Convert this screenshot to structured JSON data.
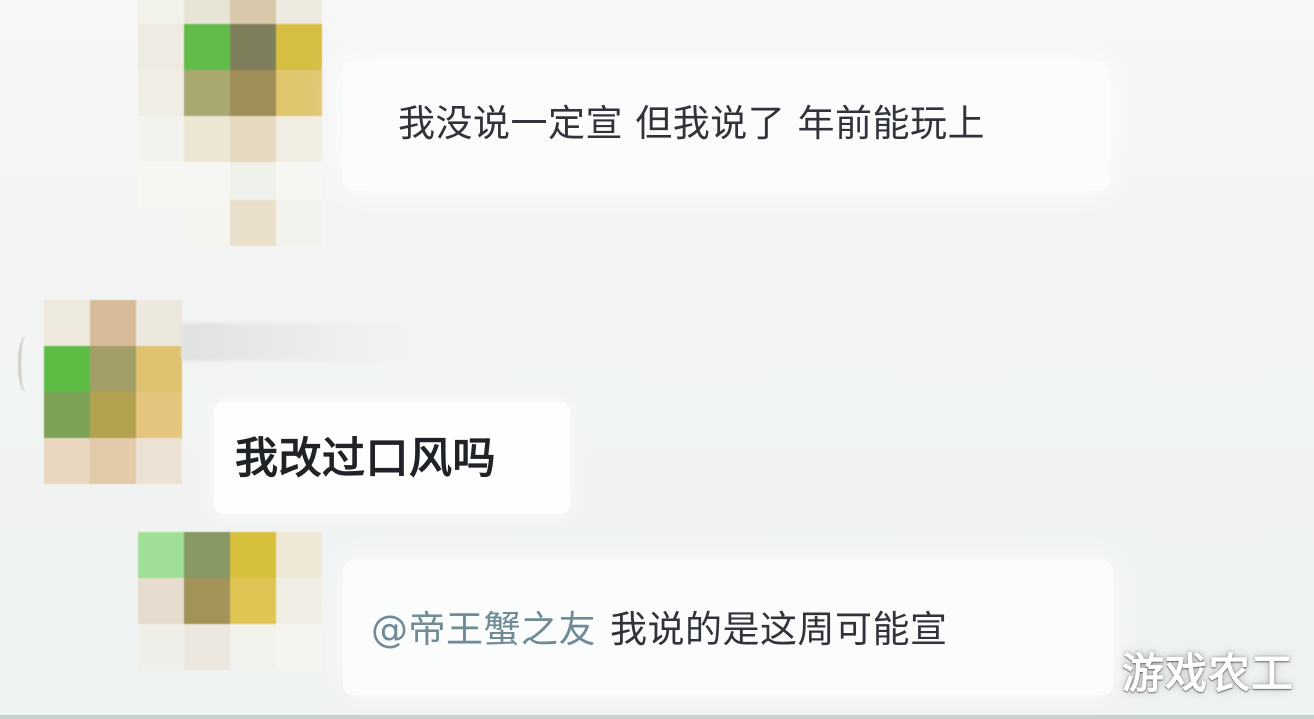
{
  "messages": {
    "first": "我没说一定宣 但我说了 年前能玩上",
    "second": "我改过口风吗",
    "third": {
      "mention": "@帝王蟹之友",
      "text": "我说的是这周可能宣"
    }
  },
  "watermark": "游戏农工",
  "colors": {
    "background": "#f3f5f4",
    "bubble": "#fdfefe",
    "text": "#30343a",
    "bold_text": "#1f2327",
    "mention": "#6f8c96",
    "watermark": "#ffffff"
  },
  "icons": {
    "avatar": "pixelated-avatar-icon"
  }
}
